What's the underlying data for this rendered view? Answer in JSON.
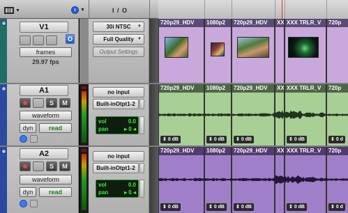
{
  "header": {
    "io_label": "I / O"
  },
  "video_track": {
    "name": "V1",
    "format_label": "frames",
    "fps": "29.97 fps",
    "io": {
      "format": "30i NTSC",
      "quality": "Full Quality",
      "settings": "Output Settings"
    },
    "o_button": "O",
    "clips": [
      "720p29_HDV",
      "1080p2",
      "720p29_HDV",
      "XX",
      "XXX TRLR_V",
      "720p"
    ]
  },
  "audio_tracks": [
    {
      "name": "A1",
      "solo": "S",
      "mute": "M",
      "view": "waveform",
      "automation_mode": "dyn",
      "read_mode": "read",
      "input": "no input",
      "output": "Built-inOtpt1-2",
      "vol_label": "vol",
      "vol_value": "0.0",
      "pan_label": "pan",
      "pan_value": "▸ 0 ◂",
      "clips": [
        {
          "title": "720p29_HDV",
          "gain": "0 dB"
        },
        {
          "title": "1080p2",
          "gain": "0 dB"
        },
        {
          "title": "720p29_HDV",
          "gain": "0 dB"
        },
        {
          "title": "XX",
          "gain": ""
        },
        {
          "title": "XXX TRLR_V",
          "gain": "0 dB"
        },
        {
          "title": "720p",
          "gain": "0 d"
        }
      ]
    },
    {
      "name": "A2",
      "solo": "S",
      "mute": "M",
      "view": "waveform",
      "automation_mode": "dyn",
      "read_mode": "read",
      "input": "no input",
      "output": "Built-inOtpt1-2",
      "vol_label": "vol",
      "vol_value": "0.0",
      "pan_label": "pan",
      "pan_value": "▸ 0 ◂",
      "clips": [
        {
          "title": "720p29_HDV",
          "gain": "0 dB"
        },
        {
          "title": "1080p2",
          "gain": "0 dB"
        },
        {
          "title": "720p29_HDV",
          "gain": "0 dB"
        },
        {
          "title": "XX",
          "gain": ""
        },
        {
          "title": "XXX TRLR_V",
          "gain": "0 dB"
        },
        {
          "title": "720p",
          "gain": "0 d"
        }
      ]
    }
  ],
  "colors": {
    "video": "#c9a8dc",
    "audio1": "#a8cf94",
    "audio2": "#a07fc9",
    "accent_blue": "#2d5fd6"
  }
}
